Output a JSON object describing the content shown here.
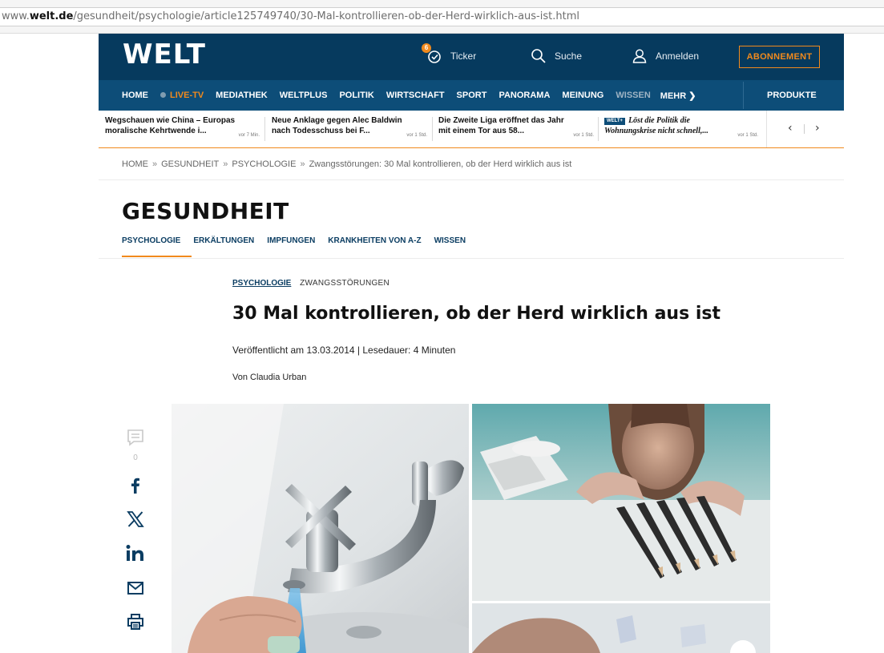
{
  "browser": {
    "url_prefix": "www.",
    "url_domain": "welt.de",
    "url_path": "/gesundheit/psychologie/article125749740/30-Mal-kontrollieren-ob-der-Herd-wirklich-aus-ist.html"
  },
  "header": {
    "logo": "WELT",
    "ticker_label": "Ticker",
    "ticker_badge": "6",
    "search_label": "Suche",
    "login_label": "Anmelden",
    "subscribe_label": "ABONNEMENT"
  },
  "nav": {
    "items": [
      "HOME",
      "LIVE-TV",
      "MEDIATHEK",
      "WELTPLUS",
      "POLITIK",
      "WIRTSCHAFT",
      "SPORT",
      "PANORAMA",
      "MEINUNG",
      "WISSEN",
      "MEHR ❯"
    ],
    "products": "PRODUKTE"
  },
  "ticker": {
    "items": [
      {
        "line1": "Wegschauen wie China – Europas",
        "line2": "moralische Kehrtwende i...",
        "time": "vor 7 Min."
      },
      {
        "line1": "Neue Anklage gegen Alec Baldwin",
        "line2": "nach Todesschuss bei F...",
        "time": "vor 1 Std."
      },
      {
        "line1": "Die Zweite Liga eröffnet das Jahr",
        "line2": "mit einem Tor aus 58...",
        "time": "vor 1 Std."
      },
      {
        "badge": "WELT+",
        "line1": "Löst die Politik die",
        "line2": "Wohnungskrise nicht schnell,...",
        "time": "vor 1 Std."
      }
    ],
    "prev": "‹",
    "next": "›"
  },
  "breadcrumb": {
    "items": [
      "HOME",
      "GESUNDHEIT",
      "PSYCHOLOGIE",
      "Zwangsstörungen: 30 Mal kontrollieren, ob der Herd wirklich aus ist"
    ],
    "separator": "»"
  },
  "section": {
    "title": "GESUNDHEIT",
    "subnav": [
      "PSYCHOLOGIE",
      "ERKÄLTUNGEN",
      "IMPFUNGEN",
      "KRANKHEITEN VON A-Z",
      "WISSEN"
    ]
  },
  "article": {
    "kicker_primary": "PSYCHOLOGIE",
    "kicker_secondary": "ZWANGSSTÖRUNGEN",
    "headline": "30 Mal kontrollieren, ob der Herd wirklich aus ist",
    "meta": "Veröffentlicht am 13.03.2014 | Lesedauer: 4 Minuten",
    "author": "Von Claudia Urban"
  },
  "share": {
    "comment_count": "0",
    "icons": [
      "comment-icon",
      "facebook-icon",
      "x-icon",
      "linkedin-icon",
      "mail-icon",
      "print-icon"
    ]
  },
  "colors": {
    "brand_dark": "#063a5e",
    "nav_blue": "#0d4d78",
    "accent_orange": "#f18a1d"
  }
}
